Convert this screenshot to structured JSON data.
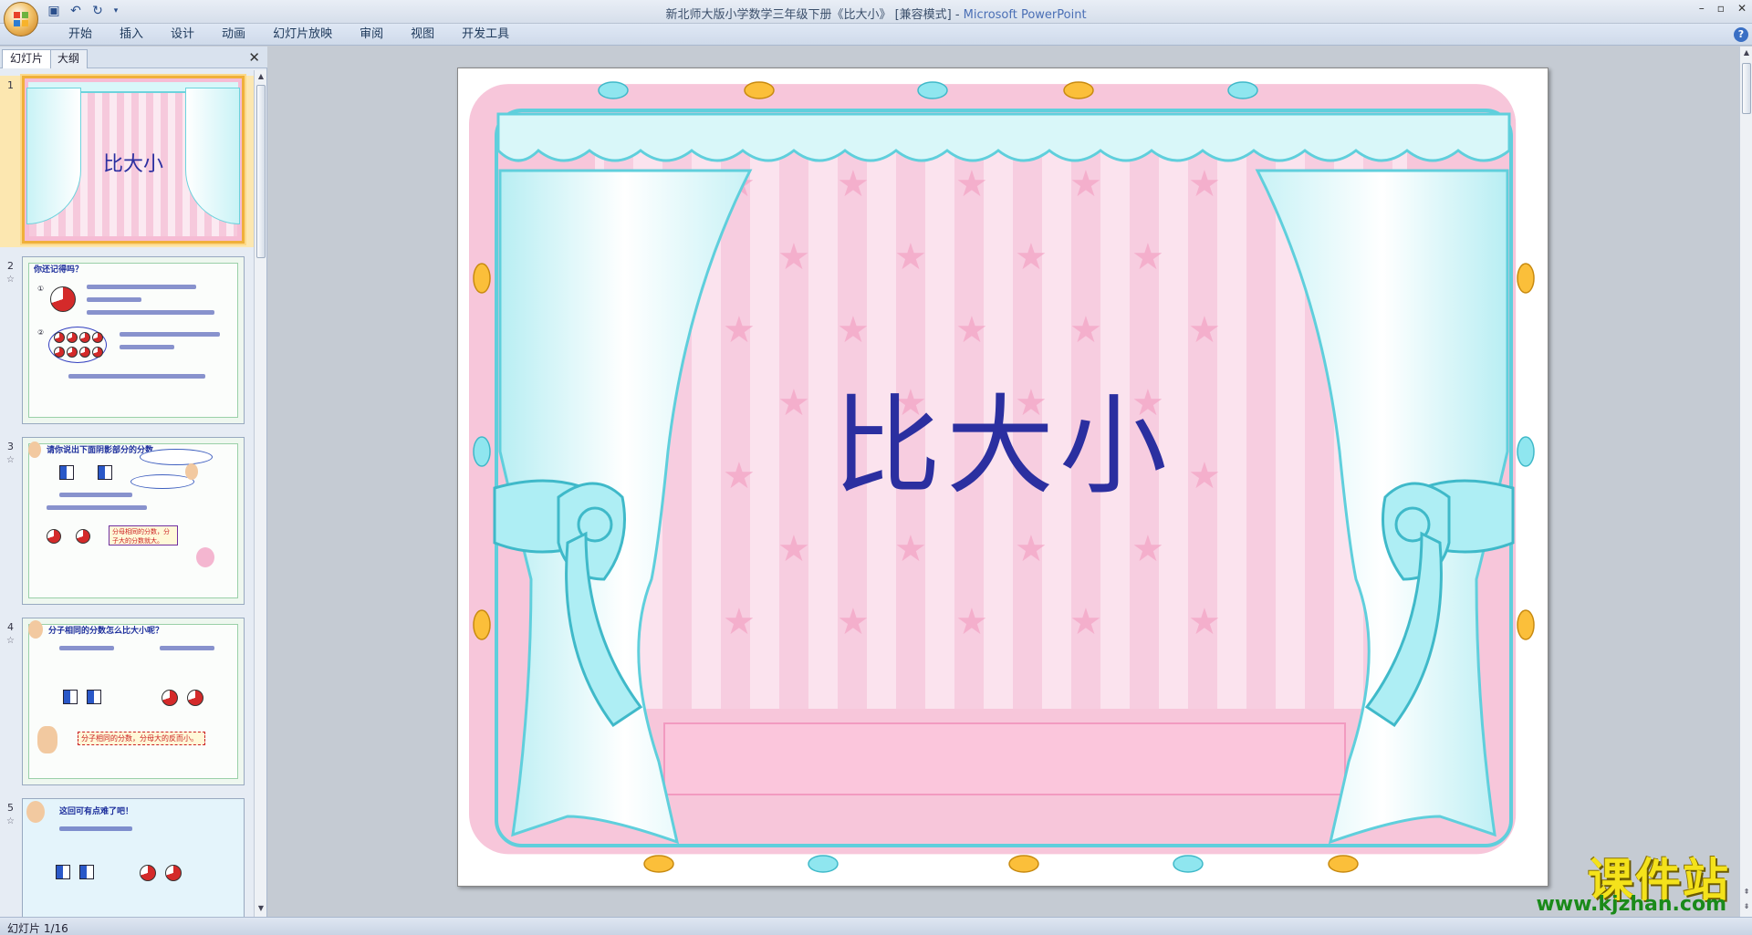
{
  "window": {
    "title": "新北师大版小学数学三年级下册《比大小》 [兼容模式] - ",
    "app_name": "Microsoft PowerPoint"
  },
  "ribbon": {
    "tabs": [
      "开始",
      "插入",
      "设计",
      "动画",
      "幻灯片放映",
      "审阅",
      "视图",
      "开发工具"
    ]
  },
  "left_pane": {
    "tabs": [
      "幻灯片",
      "大纲"
    ],
    "close": "✕",
    "slides": [
      {
        "num": "1",
        "label": "比大小"
      },
      {
        "num": "2",
        "label": "你还记得吗？"
      },
      {
        "num": "3",
        "label": "请你说出下面阴影部分的分数。"
      },
      {
        "num": "4",
        "label": "分子相同的分数怎么比大小呢？"
      },
      {
        "num": "5",
        "label": "这回可有点难了吧！"
      }
    ],
    "slide2_labels": [
      "①",
      "②"
    ],
    "slide4_label": "分子相同的分数，分母大的反而小。",
    "slide3_label": "分母相同的分数，分子大的分数就大。"
  },
  "slide": {
    "title": "比大小"
  },
  "status": {
    "text": "幻灯片 1/16"
  },
  "watermark": {
    "main": "课件站",
    "url": "www.kjzhan.com"
  },
  "colors": {
    "title_blue": "#2b2fa0",
    "curtain_cyan": "#6dd3dd",
    "stripe_pink": "#f6c9dc",
    "border_pink": "#f6bcd4"
  }
}
